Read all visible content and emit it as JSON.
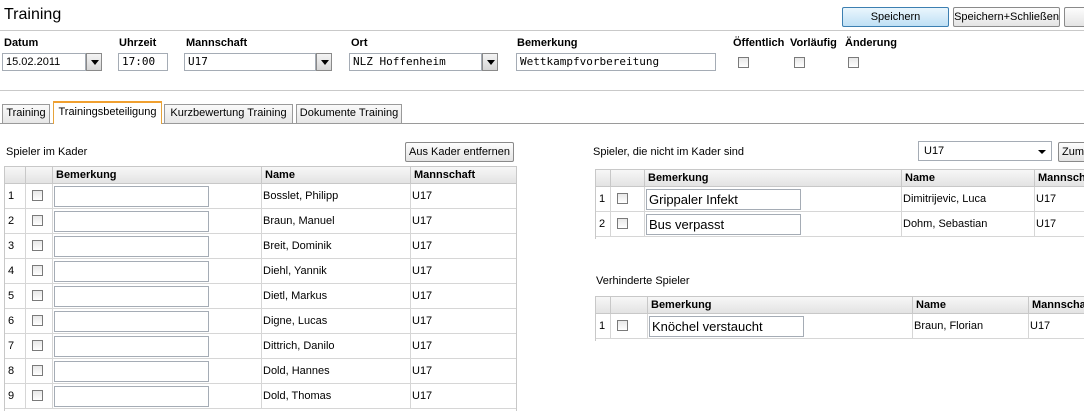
{
  "header": {
    "title": "Training",
    "save_label": "Speichern",
    "save_close_label": "Speichern+Schließen"
  },
  "form": {
    "datum_label": "Datum",
    "datum_value": "15.02.2011",
    "uhrzeit_label": "Uhrzeit",
    "uhrzeit_value": "17:00",
    "mannschaft_label": "Mannschaft",
    "mannschaft_value": "U17",
    "ort_label": "Ort",
    "ort_value": "NLZ Hoffenheim",
    "bemerkung_label": "Bemerkung",
    "bemerkung_value": "Wettkampfvorbereitung",
    "oeffentlich_label": "Öffentlich",
    "vorlaeufig_label": "Vorläufig",
    "aenderung_label": "Änderung"
  },
  "tabs": [
    "Training",
    "Trainingsbeteiligung",
    "Kurzbewertung Training",
    "Dokumente Training"
  ],
  "kader": {
    "section_label": "Spieler im Kader",
    "remove_button": "Aus Kader entfernen",
    "columns": [
      "Bemerkung",
      "Name",
      "Mannschaft"
    ],
    "rows": [
      {
        "num": "1",
        "bemerkung": "",
        "name": "Bosslet, Philipp",
        "team": "U17"
      },
      {
        "num": "2",
        "bemerkung": "",
        "name": "Braun, Manuel",
        "team": "U17"
      },
      {
        "num": "3",
        "bemerkung": "",
        "name": "Breit, Dominik",
        "team": "U17"
      },
      {
        "num": "4",
        "bemerkung": "",
        "name": "Diehl, Yannik",
        "team": "U17"
      },
      {
        "num": "5",
        "bemerkung": "",
        "name": "Dietl, Markus",
        "team": "U17"
      },
      {
        "num": "6",
        "bemerkung": "",
        "name": "Digne, Lucas",
        "team": "U17"
      },
      {
        "num": "7",
        "bemerkung": "",
        "name": "Dittrich, Danilo",
        "team": "U17"
      },
      {
        "num": "8",
        "bemerkung": "",
        "name": "Dold, Hannes",
        "team": "U17"
      },
      {
        "num": "9",
        "bemerkung": "",
        "name": "Dold, Thomas",
        "team": "U17"
      }
    ]
  },
  "nicht_kader": {
    "section_label": "Spieler, die nicht im Kader sind",
    "team_select": "U17",
    "add_button": "Zum K",
    "columns": [
      "Bemerkung",
      "Name",
      "Mannschaft"
    ],
    "rows": [
      {
        "num": "1",
        "bemerkung": "Grippaler Infekt",
        "name": "Dimitrijevic, Luca",
        "team": "U17"
      },
      {
        "num": "2",
        "bemerkung": "Bus verpasst",
        "name": "Dohm, Sebastian",
        "team": "U17"
      }
    ]
  },
  "verhindert": {
    "section_label": "Verhinderte Spieler",
    "columns": [
      "Bemerkung",
      "Name",
      "Mannschaft"
    ],
    "rows": [
      {
        "num": "1",
        "bemerkung": "Knöchel verstaucht",
        "name": "Braun, Florian",
        "team": "U17"
      }
    ]
  }
}
